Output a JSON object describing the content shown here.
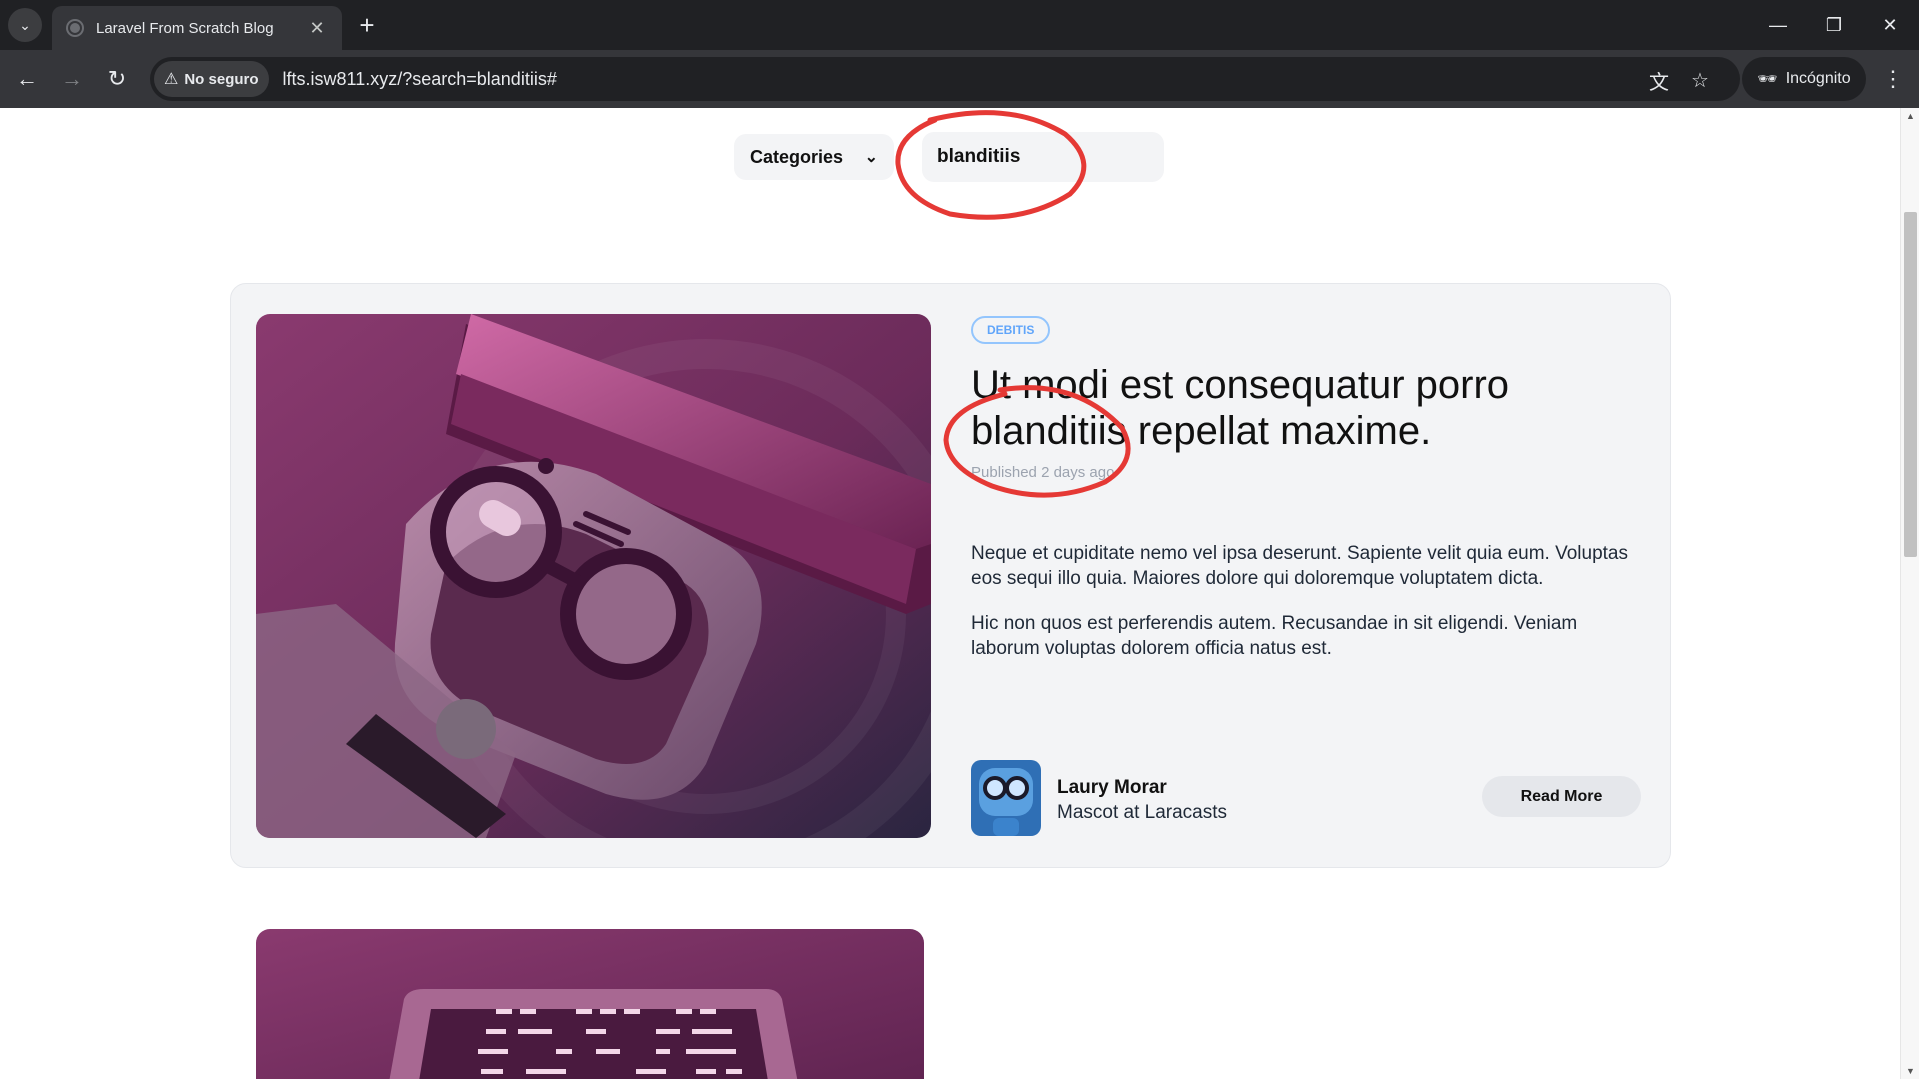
{
  "browser": {
    "tab_title": "Laravel From Scratch Blog",
    "security_label": "No seguro",
    "url": "lfts.isw811.xyz/?search=blanditiis#",
    "incognito_label": "Incógnito"
  },
  "filters": {
    "categories_label": "Categories",
    "search_value": "blanditiis"
  },
  "post": {
    "category": "DEBITIS",
    "title": "Ut modi est consequatur porro blanditiis repellat maxime.",
    "published_prefix": "Published",
    "published_time": "2 days ago",
    "excerpt": [
      "Neque et cupiditate nemo vel ipsa deserunt. Sapiente velit quia eum. Voluptas eos sequi illo quia. Maiores dolore qui doloremque voluptatem dicta.",
      "Hic non quos est perferendis autem. Recusandae in sit eligendi. Veniam laborum voluptas dolorem officia natus est."
    ],
    "author_name": "Laury Morar",
    "author_role": "Mascot at Laracasts",
    "read_more_label": "Read More"
  },
  "colors": {
    "accent_badge": "#60a5fa",
    "annotation": "#e53935",
    "card_bg": "#f3f4f6"
  },
  "icons": {
    "tab_search": "chevron-down-icon",
    "new_tab": "plus-icon",
    "back": "arrow-left-icon",
    "forward": "arrow-right-icon",
    "reload": "reload-icon",
    "translate": "translate-icon",
    "bookmark": "star-icon",
    "incognito": "incognito-icon",
    "menu": "kebab-menu-icon"
  }
}
